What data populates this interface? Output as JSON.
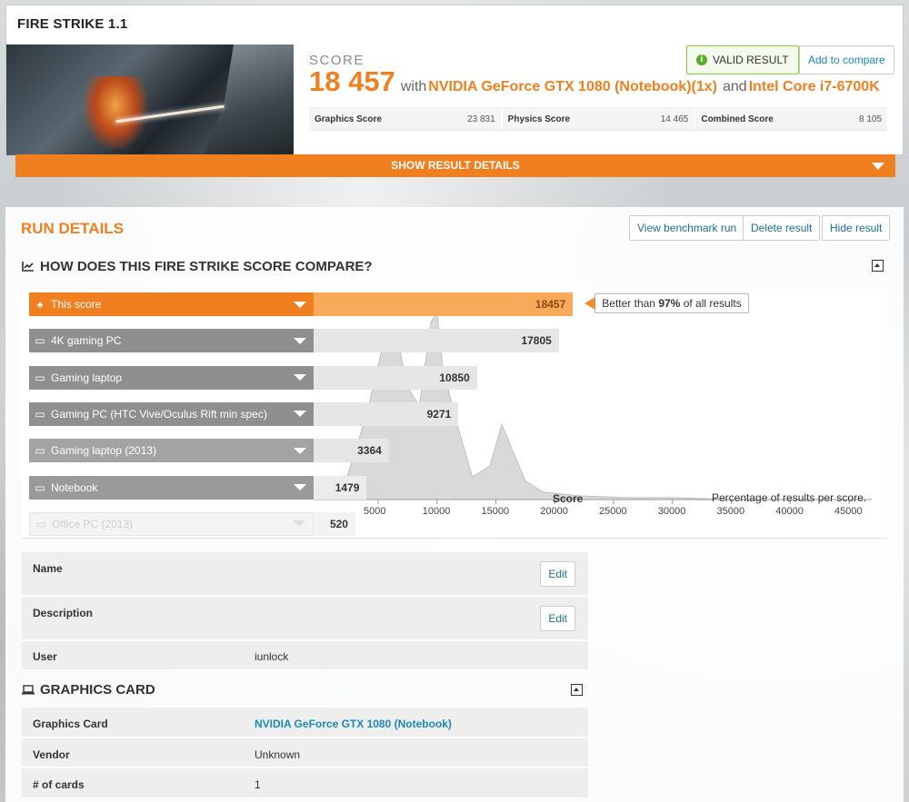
{
  "result": {
    "title": "FIRE STRIKE 1.1",
    "score_label": "SCORE",
    "score_value": "18 457",
    "with_word": "with",
    "gpu": "NVIDIA GeForce GTX 1080 (Notebook)(1x)",
    "and_word": "and",
    "cpu": "Intel Core i7-6700K",
    "valid_label": "VALID RESULT",
    "compare_label": "Add to compare",
    "subscores": [
      {
        "name": "Graphics Score",
        "value": "23 831"
      },
      {
        "name": "Physics Score",
        "value": "14 465"
      },
      {
        "name": "Combined Score",
        "value": "8 105"
      }
    ],
    "show_details_label": "SHOW RESULT DETAILS"
  },
  "run": {
    "title": "RUN DETAILS",
    "buttons": [
      "View benchmark run",
      "Delete result",
      "Hide result"
    ],
    "compare_title": "HOW DOES THIS FIRE STRIKE SCORE COMPARE?",
    "tooltip_prefix": "Better than",
    "tooltip_pct": "97%",
    "tooltip_suffix": "of all results"
  },
  "chart_data": {
    "type": "bar",
    "categories": [
      "This score",
      "4K gaming PC",
      "Gaming laptop",
      "Gaming PC (HTC Vive/Oculus Rift min spec)",
      "Gaming laptop (2013)",
      "Notebook",
      "Office PC (2013)"
    ],
    "values": [
      18457,
      17805,
      10850,
      9271,
      3364,
      1479,
      520
    ],
    "xlabel": "Score",
    "annotation": "Percentage of results per score.",
    "xlim": [
      0,
      46000
    ],
    "xticks": [
      5000,
      10000,
      15000,
      20000,
      25000,
      30000,
      35000,
      40000,
      45000
    ],
    "distribution": {
      "type": "area",
      "x": [
        2000,
        4000,
        5500,
        6500,
        7500,
        8500,
        9500,
        10000,
        10500,
        11500,
        13000,
        14500,
        15500,
        16500,
        17500,
        19000,
        22000,
        26000,
        30000,
        35000,
        40000,
        45000
      ],
      "y": [
        0.05,
        0.45,
        0.85,
        0.9,
        0.6,
        0.5,
        0.95,
        1.0,
        0.7,
        0.45,
        0.12,
        0.18,
        0.4,
        0.25,
        0.1,
        0.04,
        0.02,
        0.01,
        0.01,
        0.0,
        0.0,
        0.0
      ]
    }
  },
  "details": {
    "rows": [
      {
        "key": "Name",
        "value": "",
        "edit": "Edit"
      },
      {
        "key": "Description",
        "value": "",
        "edit": "Edit"
      },
      {
        "key": "User",
        "value": "iunlock"
      }
    ]
  },
  "graphics_card": {
    "title": "GRAPHICS CARD",
    "rows": [
      {
        "key": "Graphics Card",
        "value": "NVIDIA GeForce GTX 1080 (Notebook)"
      },
      {
        "key": "Vendor",
        "value": "Unknown"
      },
      {
        "key": "# of cards",
        "value": "1"
      }
    ]
  },
  "colors": {
    "accent": "#f07f1f",
    "this_bar": "#f8a95a",
    "row_gray": "#8f8f8f",
    "link": "#1b8ab5",
    "valid": "#8cc63f"
  }
}
